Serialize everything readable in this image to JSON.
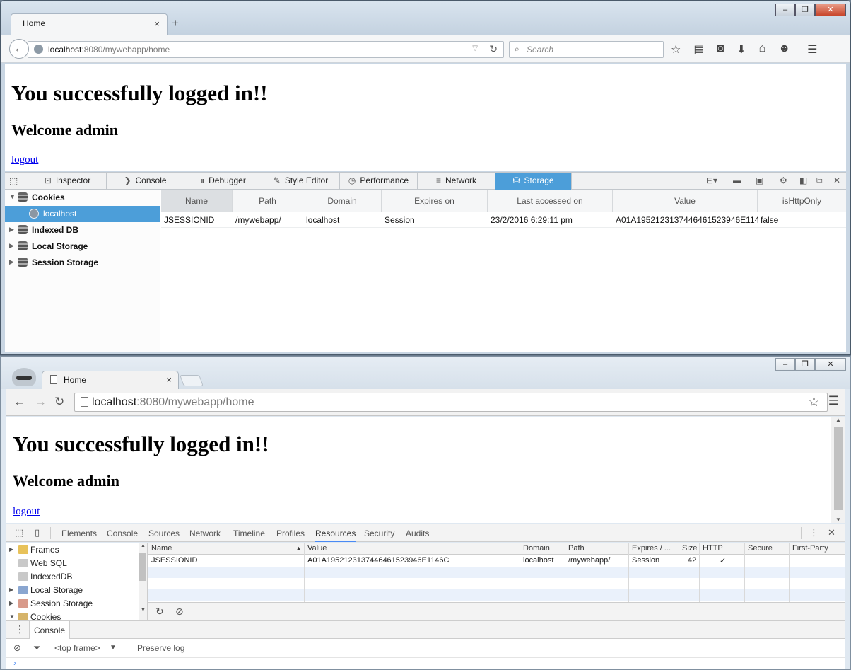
{
  "firefox": {
    "tab_title": "Home",
    "tab_close": "×",
    "new_tab": "+",
    "url_host": "localhost",
    "url_rest": ":8080/mywebapp/home",
    "search_placeholder": "Search",
    "page": {
      "heading": "You successfully logged in!!",
      "welcome": "Welcome admin",
      "logout": "logout"
    },
    "devtools_tabs": [
      "Inspector",
      "Console",
      "Debugger",
      "Style Editor",
      "Performance",
      "Network",
      "Storage"
    ],
    "tree": {
      "cookies": "Cookies",
      "localhost": "localhost",
      "indexed_db": "Indexed DB",
      "local_storage": "Local Storage",
      "session_storage": "Session Storage"
    },
    "columns": [
      "Name",
      "Path",
      "Domain",
      "Expires on",
      "Last accessed on",
      "Value",
      "isHttpOnly"
    ],
    "rows": [
      [
        "JSESSIONID",
        "/mywebapp/",
        "localhost",
        "Session",
        "23/2/2016 6:29:11 pm",
        "A01A19521231374464615239​46E114...",
        "false"
      ]
    ]
  },
  "chrome": {
    "tab_title": "Home",
    "tab_close": "×",
    "url_host": "localhost",
    "url_rest": ":8080/mywebapp/home",
    "page": {
      "heading": "You successfully logged in!!",
      "welcome": "Welcome admin",
      "logout": "logout"
    },
    "devtools_tabs": [
      "Elements",
      "Console",
      "Sources",
      "Network",
      "Timeline",
      "Profiles",
      "Resources",
      "Security",
      "Audits"
    ],
    "tree": [
      "Frames",
      "Web SQL",
      "IndexedDB",
      "Local Storage",
      "Session Storage",
      "Cookies"
    ],
    "columns": [
      "Name",
      "Value",
      "Domain",
      "Path",
      "Expires / ...",
      "Size",
      "HTTP",
      "Secure",
      "First-Party"
    ],
    "row": {
      "name": "JSESSIONID",
      "value": "A01A19521231374464615239​46E1146C",
      "domain": "localhost",
      "path": "/mywebapp/",
      "expires": "Session",
      "size": "42",
      "http": "✓"
    },
    "drawer_tab": "Console",
    "frame_select": "<top frame>",
    "preserve_log": "Preserve log",
    "prompt": "›"
  }
}
